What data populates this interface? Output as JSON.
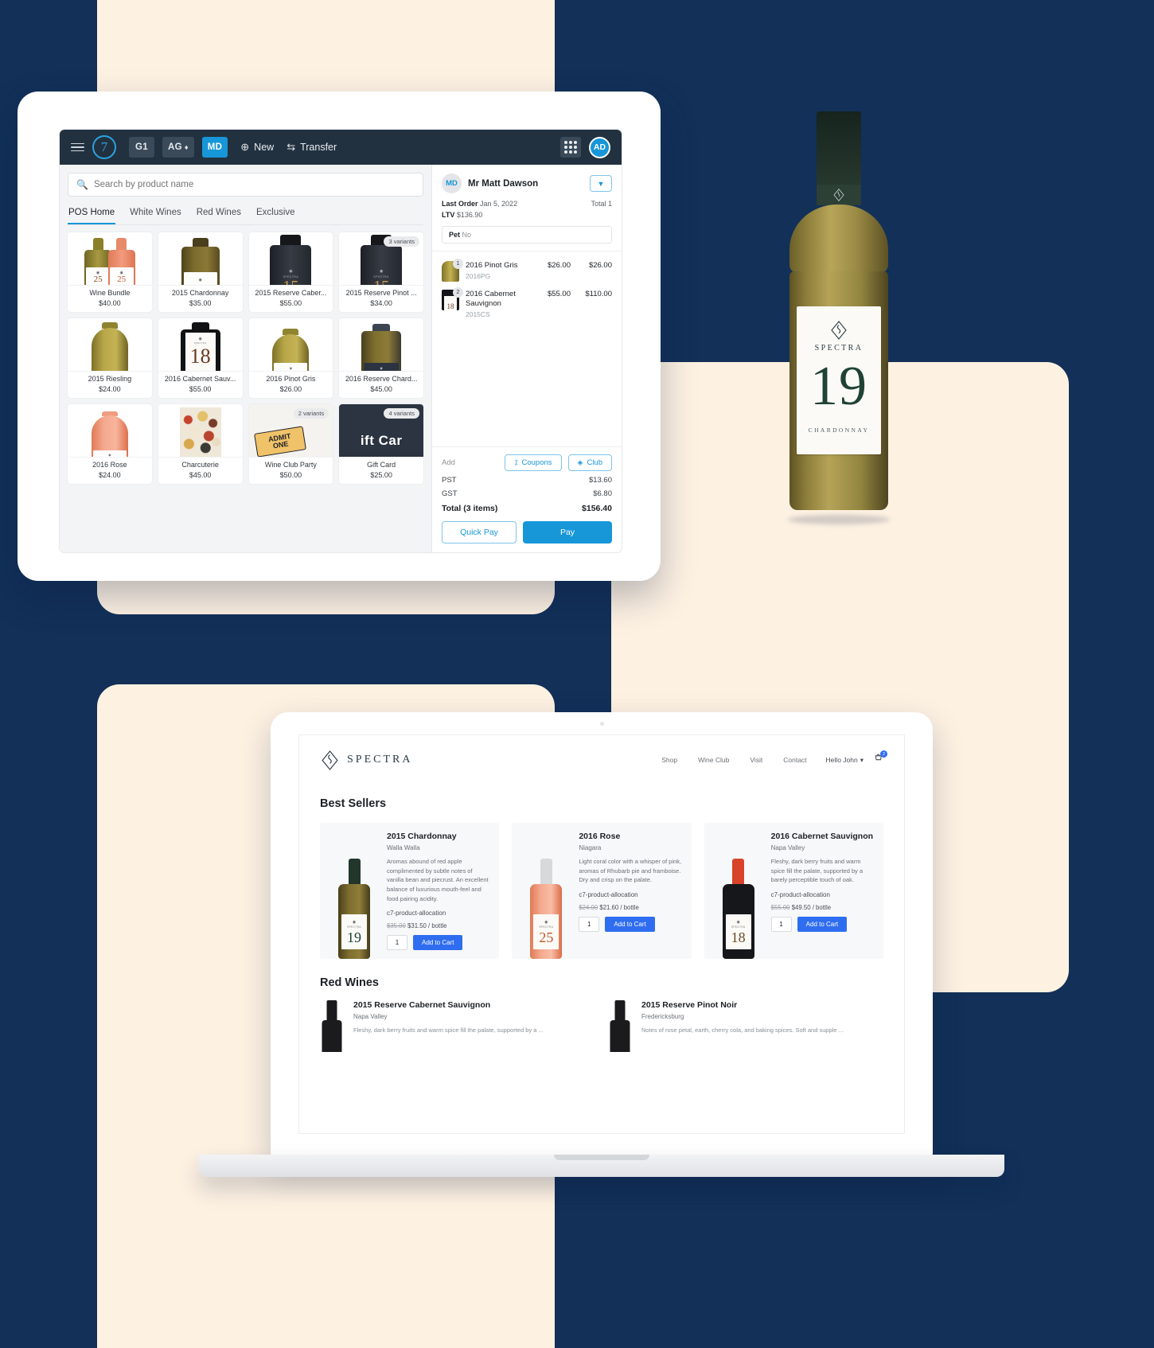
{
  "pos": {
    "topbar": {
      "menu_icon": "hamburger-icon",
      "logo": "7",
      "chips": [
        {
          "label": "G1",
          "gem": false,
          "active": false
        },
        {
          "label": "AG",
          "gem": true,
          "active": false
        },
        {
          "label": "MD",
          "gem": false,
          "active": true
        }
      ],
      "new_label": "New",
      "transfer_label": "Transfer",
      "grid_icon": "grid-icon",
      "avatar": "AD"
    },
    "search_placeholder": "Search by product name",
    "tabs": [
      {
        "label": "POS Home",
        "active": true
      },
      {
        "label": "White Wines",
        "active": false
      },
      {
        "label": "Red Wines",
        "active": false
      },
      {
        "label": "Exclusive",
        "active": false
      }
    ],
    "products": [
      {
        "name": "Wine Bundle",
        "price": "$40.00",
        "variants": "",
        "art": "bundle"
      },
      {
        "name": "2015 Chardonnay",
        "price": "$35.00",
        "variants": "",
        "art": "white"
      },
      {
        "name": "2015 Reserve Caber...",
        "price": "$55.00",
        "variants": "",
        "art": "dark15"
      },
      {
        "name": "2015 Reserve Pinot ...",
        "price": "$34.00",
        "variants": "3 variants",
        "art": "dark15"
      },
      {
        "name": "2015 Riesling",
        "price": "$24.00",
        "variants": "",
        "art": "gold"
      },
      {
        "name": "2016 Cabernet Sauv...",
        "price": "$55.00",
        "variants": "",
        "art": "red18"
      },
      {
        "name": "2016 Pinot Gris",
        "price": "$26.00",
        "variants": "",
        "art": "gold"
      },
      {
        "name": "2016 Reserve Chard...",
        "price": "$45.00",
        "variants": "",
        "art": "olive"
      },
      {
        "name": "2016 Rose",
        "price": "$24.00",
        "variants": "",
        "art": "rose"
      },
      {
        "name": "Charcuterie",
        "price": "$45.00",
        "variants": "",
        "art": "charcuterie"
      },
      {
        "name": "Wine Club Party",
        "price": "$50.00",
        "variants": "2 variants",
        "art": "ticket"
      },
      {
        "name": "Gift Card",
        "price": "$25.00",
        "variants": "4 variants",
        "art": "giftcard"
      }
    ],
    "cart": {
      "avatar": "MD",
      "customer": "Mr Matt Dawson",
      "chevron_icon": "chevron-down-icon",
      "last_order_label": "Last Order",
      "last_order_value": "Jan 5, 2022",
      "total_label": "Total",
      "total_count": "1",
      "ltv_label": "LTV",
      "ltv_value": "$136.90",
      "pet_label": "Pet",
      "pet_value": "No",
      "lines": [
        {
          "qty": "1",
          "name": "2016 Pinot Gris",
          "sku": "2016PG",
          "price": "$26.00",
          "total": "$26.00",
          "art": "gold"
        },
        {
          "qty": "2",
          "name": "2016 Cabernet Sauvignon",
          "sku": "2015CS",
          "price": "$55.00",
          "total": "$110.00",
          "art": "red18"
        }
      ],
      "add_label": "Add",
      "coupons_label": "Coupons",
      "coupons_icon": "percent-icon",
      "club_label": "Club",
      "club_icon": "diamond-icon",
      "pst_label": "PST",
      "pst_value": "$13.60",
      "gst_label": "GST",
      "gst_value": "$6.80",
      "total_row_label": "Total (3 items)",
      "total_row_value": "$156.40",
      "quick_pay_label": "Quick Pay",
      "pay_label": "Pay"
    }
  },
  "hero_bottle": {
    "brand": "SPECTRA",
    "vintage": "19",
    "variety": "CHARDONNAY"
  },
  "site": {
    "brand": "SPECTRA",
    "nav": [
      {
        "label": "Shop"
      },
      {
        "label": "Wine Club"
      },
      {
        "label": "Visit"
      },
      {
        "label": "Contact"
      }
    ],
    "account_label": "Hello John",
    "cart_icon": "cart-icon",
    "cart_count": "2",
    "best_sellers_heading": "Best Sellers",
    "best_sellers": [
      {
        "title": "2015 Chardonnay",
        "region": "Walla Walla",
        "desc": "Aromas abound of red apple complimented by subtle notes of vanilla bean and piecrust. An excellent balance of luxurious mouth-feel and food pairing acidity.",
        "allocation": "c7-product-allocation",
        "old_price": "$35.00",
        "price": "$31.50 / bottle",
        "qty": "1",
        "cta": "Add to Cart",
        "art": "white",
        "label_big": "19"
      },
      {
        "title": "2016 Rose",
        "region": "Niagara",
        "desc": "Light coral color with a whisper of pink, aromas of Rhubarb pie and framboise. Dry and crisp on the palate.",
        "allocation": "c7-product-allocation",
        "old_price": "$24.00",
        "price": "$21.60 / bottle",
        "qty": "1",
        "cta": "Add to Cart",
        "art": "rose",
        "label_big": "25"
      },
      {
        "title": "2016 Cabernet Sauvignon",
        "region": "Napa Valley",
        "desc": "Fleshy, dark berry fruits and warm spice fill the palate, supported by a barely perceptible touch of oak.",
        "allocation": "c7-product-allocation",
        "old_price": "$55.00",
        "price": "$49.50 / bottle",
        "qty": "1",
        "cta": "Add to Cart",
        "art": "red",
        "label_big": "18"
      }
    ],
    "red_wines_heading": "Red Wines",
    "red_wines": [
      {
        "title": "2015 Reserve Cabernet Sauvignon",
        "region": "Napa Valley",
        "desc": "Fleshy, dark berry fruits and warm spice fill the palate, supported by a ..."
      },
      {
        "title": "2015 Reserve Pinot Noir",
        "region": "Fredericksburg",
        "desc": "Notes of rose petal, earth, cherry cola, and baking spices. Soft and supple ..."
      }
    ]
  },
  "colors": {
    "accent_blue": "#1796d8",
    "cta_blue": "#2f6df0",
    "dark_bar": "#22313f",
    "page_navy": "#123058",
    "cream": "#FDF1E2"
  }
}
